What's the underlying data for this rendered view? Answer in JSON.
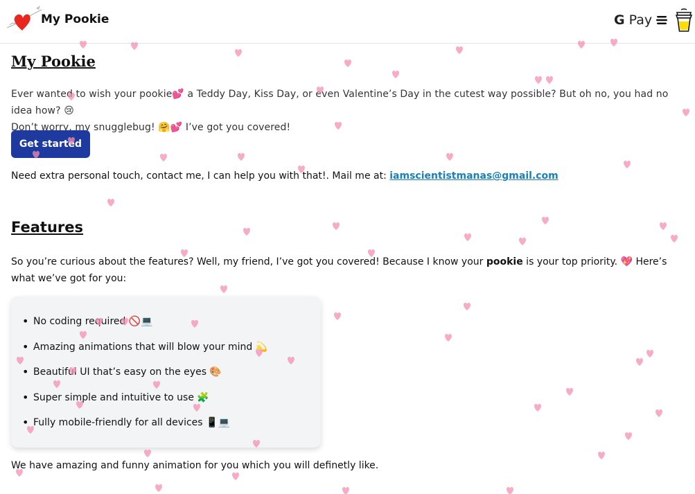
{
  "nav": {
    "brand": "My Pookie",
    "gpay_g": "G",
    "gpay_label": "Pay"
  },
  "hero": {
    "title": "My Pookie",
    "intro_line1": "Ever wanted to wish your pookie💕 a Teddy Day, Kiss Day, or even Valentine’s Day in the cutest way possible? But oh no, you had no idea how? 😢",
    "intro_line2": "Don’t worry, my snugglebug! 🤗💕 I’ve got you covered!",
    "cta_label": "Get started",
    "contact_text": "Need extra personal touch, contact me, I can help you with that!. Mail me at: ",
    "contact_email": "iamscientistmanas@gmail.com"
  },
  "features": {
    "heading": "Features",
    "intro_a": "So you’re curious about the features? Well, my friend, I’ve got you covered! Because I know your ",
    "intro_bold": "pookie",
    "intro_b": " is your top priority. 💖 Here’s what we’ve got for you:",
    "items": [
      "No coding required 🚫💻",
      "Amazing animations that will blow your mind 💫",
      "Beautiful UI that’s easy on the eyes 🎨",
      "Super simple and intuitive to use 🧩",
      "Fully mobile-friendly for all devices 📱💻"
    ],
    "outro": "We have amazing and funny animation for you which you will definetly like."
  },
  "colors": {
    "accent": "#1f3a9e",
    "link": "#1a7fb8",
    "heart": "#f48fb1"
  }
}
